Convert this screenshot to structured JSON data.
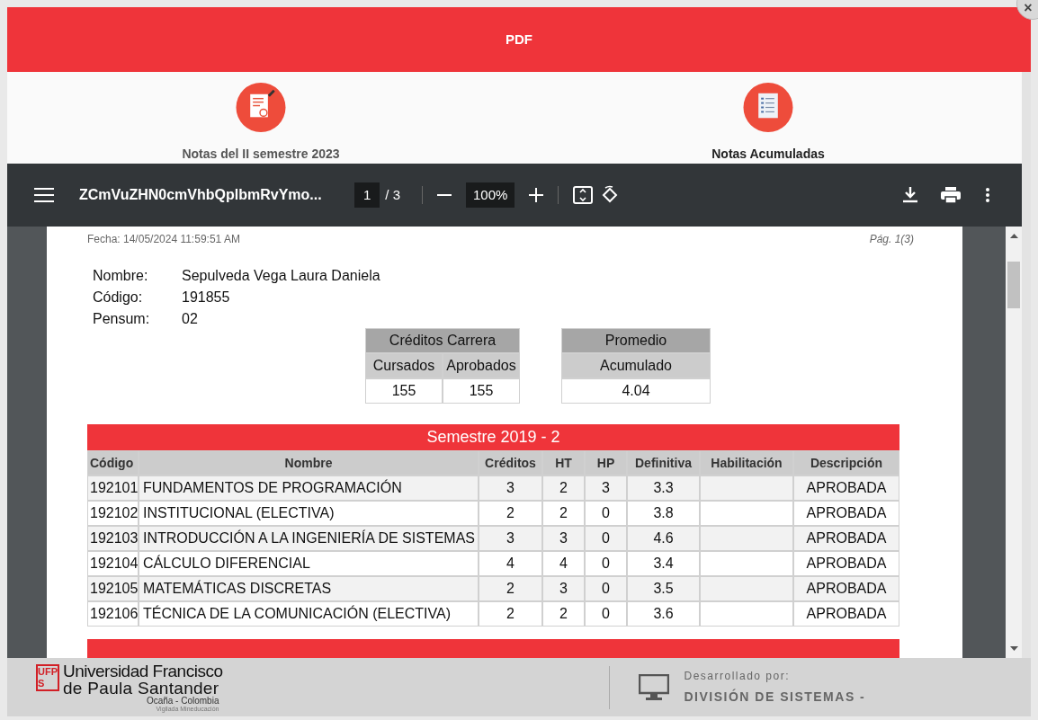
{
  "modal": {
    "title": "PDF",
    "close": "×"
  },
  "options": [
    {
      "label": "Notas del II semestre 2023",
      "selected": false,
      "kind": "pen"
    },
    {
      "label": "Notas Acumuladas",
      "selected": true,
      "kind": "list"
    }
  ],
  "viewer": {
    "filename": "ZCmVuZHN0cmVhbQplbmRvYmo...",
    "page": "1",
    "pages": "/ 3",
    "zoom": "100%"
  },
  "document": {
    "date": "Fecha: 14/05/2024 11:59:51 AM",
    "page_label": "Pág. 1(3)",
    "info": [
      {
        "label": "Nombre:",
        "value": "Sepulveda Vega Laura Daniela"
      },
      {
        "label": "Código:",
        "value": "191855"
      },
      {
        "label": "Pensum:",
        "value": "02"
      }
    ],
    "credits": {
      "title": "Créditos Carrera",
      "columns": [
        "Cursados",
        "Aprobados"
      ],
      "values": [
        "155",
        "155"
      ]
    },
    "average": {
      "title": "Promedio",
      "subtitle": "Acumulado",
      "value": "4.04"
    },
    "semesters": [
      {
        "title": "Semestre 2019 - 2",
        "columns": [
          "Código",
          "Nombre",
          "Créditos",
          "HT",
          "HP",
          "Definitiva",
          "Habilitación",
          "Descripción"
        ],
        "rows": [
          [
            "192101",
            "FUNDAMENTOS DE PROGRAMACIÓN",
            "3",
            "2",
            "3",
            "3.3",
            "",
            "APROBADA"
          ],
          [
            "192102",
            "INSTITUCIONAL (ELECTIVA)",
            "2",
            "2",
            "0",
            "3.8",
            "",
            "APROBADA"
          ],
          [
            "192103",
            "INTRODUCCIÓN A LA INGENIERÍA DE SISTEMAS",
            "3",
            "3",
            "0",
            "4.6",
            "",
            "APROBADA"
          ],
          [
            "192104",
            "CÁLCULO DIFERENCIAL",
            "4",
            "4",
            "0",
            "3.4",
            "",
            "APROBADA"
          ],
          [
            "192105",
            "MATEMÁTICAS DISCRETAS",
            "2",
            "3",
            "0",
            "3.5",
            "",
            "APROBADA"
          ],
          [
            "192106",
            "TÉCNICA DE LA COMUNICACIÓN (ELECTIVA)",
            "2",
            "2",
            "0",
            "3.6",
            "",
            "APROBADA"
          ]
        ]
      }
    ]
  },
  "footer": {
    "logo_mark": "UFPS",
    "university_line1": "Universidad Francisco",
    "university_line2": "de Paula Santander",
    "city": "Ocaña - Colombia",
    "note": "Vigilada Mineducación",
    "developed_label": "Desarrollado por:",
    "developer": "DIVISIÓN DE SISTEMAS -"
  }
}
